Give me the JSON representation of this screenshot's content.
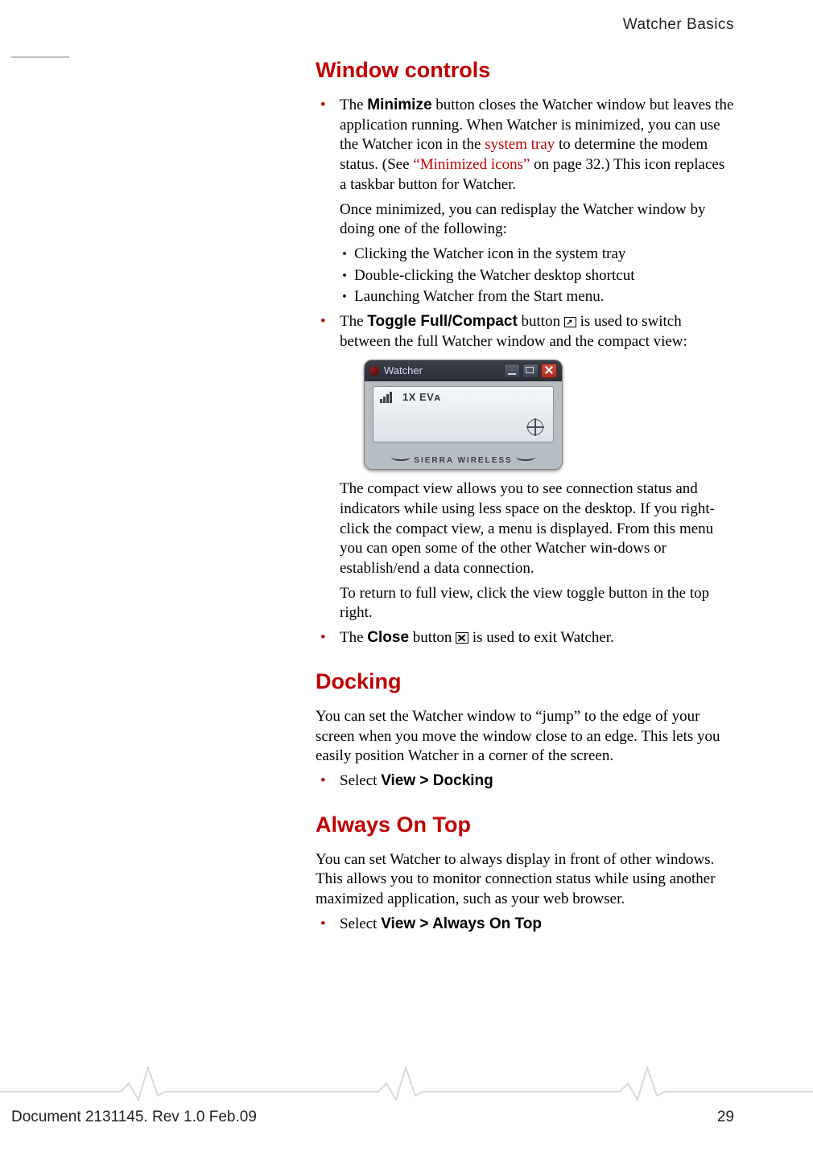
{
  "header": {
    "running": "Watcher Basics"
  },
  "sections": {
    "window_controls": {
      "title": "Window controls",
      "minimize": {
        "pre": "The ",
        "bold": "Minimize",
        "t1": " button closes the Watcher window but leaves the application running. When Watcher is minimized, you can use the Watcher icon in the ",
        "link1": "system tray",
        "t2": " to determine the modem status. (See ",
        "link2": "“Minimized icons”",
        "t3": " on page 32.) This icon replaces a taskbar button for Watcher."
      },
      "redisplay_intro": "Once minimized, you can redisplay the Watcher window by doing one of the following:",
      "redisplay": {
        "a": "Clicking the Watcher icon in the system tray",
        "b": "Double-clicking the Watcher desktop shortcut",
        "c": "Launching Watcher from the Start menu."
      },
      "toggle": {
        "pre": "The ",
        "bold": "Toggle Full/Compact",
        "t1": " button ",
        "t2": " is used to switch between the full Watcher window and the compact view:"
      },
      "compact_desc": "The compact view allows you to see connection status and indicators while using less space on the desktop. If you right-click the compact view, a menu is displayed. From this menu you can open some of the other Watcher win‑dows or establish/end a data connection.",
      "return_full": "To return to full view, click the view toggle button in the top right.",
      "close": {
        "pre": "The ",
        "bold": "Close",
        "t1": " button ",
        "t2": " is used to exit Watcher."
      }
    },
    "docking": {
      "title": "Docking",
      "para": "You can set the Watcher window to “jump” to the edge of your screen when you move the window close to an edge. This lets you easily position Watcher in a corner of the screen.",
      "select_pre": "Select ",
      "select_bold": "View > Docking"
    },
    "always": {
      "title": "Always On Top",
      "para": "You can set Watcher to always display in front of other windows. This allows you to monitor connection status while using another maximized application, such as your web browser.",
      "select_pre": "Select ",
      "select_bold": "View > Always On Top"
    }
  },
  "device": {
    "title": "Watcher",
    "status": "1X   EVᴀ",
    "brand": "SIERRA WIRELESS"
  },
  "footer": {
    "doc": "Document 2131145. Rev 1.0  Feb.09",
    "page": "29"
  }
}
